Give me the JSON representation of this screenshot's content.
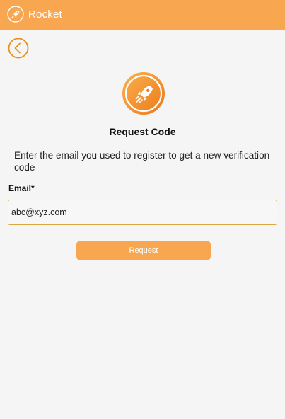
{
  "app_bar": {
    "title": "Rocket",
    "logo_icon": "rocket-icon",
    "background": "#f9a650"
  },
  "header": {
    "back_icon": "chevron-left-circle-icon",
    "hero_icon": "rocket-icon",
    "title": "Request Code"
  },
  "form": {
    "instructions": "Enter the email you used to register to get a new verification code",
    "email_label": "Email*",
    "email_value": "abc@xyz.com",
    "submit_label": "Request"
  },
  "colors": {
    "accent": "#f9a650",
    "accent_dark": "#e8831f",
    "input_border": "#d9a740",
    "content_background": "#f5f5f5"
  }
}
